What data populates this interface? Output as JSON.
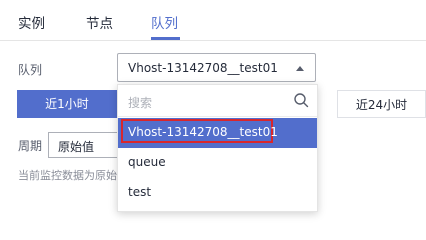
{
  "tabs": [
    {
      "label": "实例",
      "active": false
    },
    {
      "label": "节点",
      "active": false
    },
    {
      "label": "队列",
      "active": true
    }
  ],
  "queue_field": {
    "label": "队列",
    "selected": "Vhost-13142708__test01"
  },
  "time_buttons": [
    {
      "label": "近1小时",
      "active": true
    },
    {
      "label": "近24小时",
      "active": false
    }
  ],
  "period": {
    "label": "周期",
    "selected": "原始值"
  },
  "note": "当前监控数据为原始值",
  "dropdown": {
    "search_placeholder": "搜索",
    "options": [
      {
        "label": "Vhost-13142708__test01",
        "selected": true
      },
      {
        "label": "queue",
        "selected": false
      },
      {
        "label": "test",
        "selected": false
      }
    ]
  },
  "colors": {
    "accent": "#526ecc",
    "highlight_border": "#d9262c"
  }
}
